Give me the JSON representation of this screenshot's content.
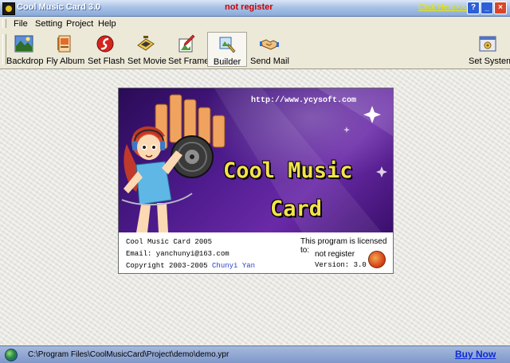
{
  "window": {
    "title": "Cool Music Card 3.0",
    "registration_status": "not register",
    "promo_link": "Click Here>>>",
    "help_button": "?",
    "minimize_button": "_",
    "close_button": "×"
  },
  "menu": [
    "File",
    "Setting",
    "Project",
    "Help"
  ],
  "toolbar": {
    "buttons": [
      {
        "label": "Backdrop",
        "icon": "landscape-icon"
      },
      {
        "label": "Fly Album",
        "icon": "album-icon"
      },
      {
        "label": "Set Flash",
        "icon": "flash-icon"
      },
      {
        "label": "Set Movie",
        "icon": "movie-icon"
      },
      {
        "label": "Set Frame",
        "icon": "frame-icon"
      },
      {
        "label": "Builder",
        "icon": "builder-icon",
        "active": true
      },
      {
        "label": "Send Mail",
        "icon": "handshake-icon"
      },
      {
        "label": "Set System",
        "icon": "system-icon"
      }
    ]
  },
  "splash": {
    "url": "http://www.ycysoft.com",
    "headline_line1": "Cool Music",
    "headline_line2": "Card",
    "product": "Cool Music Card 2005",
    "email": "Email: yanchunyi@163.com",
    "copyright_prefix": "Copyright 2003-2005 ",
    "author": "Chunyi Yan",
    "license_label": "This program is licensed to:",
    "license_status": "not register",
    "version": "Version: 3.0"
  },
  "status": {
    "path": "C:\\Program Files\\CoolMusicCard\\Project\\demo\\demo.ypr",
    "buy_now": "Buy Now"
  },
  "colors": {
    "title_bar": "#8aa9d8",
    "splash_purple": "#4c1a8a",
    "headline_yellow": "#f3e24c",
    "alert_red": "#cc0000",
    "link_blue": "#0b2bd9"
  }
}
